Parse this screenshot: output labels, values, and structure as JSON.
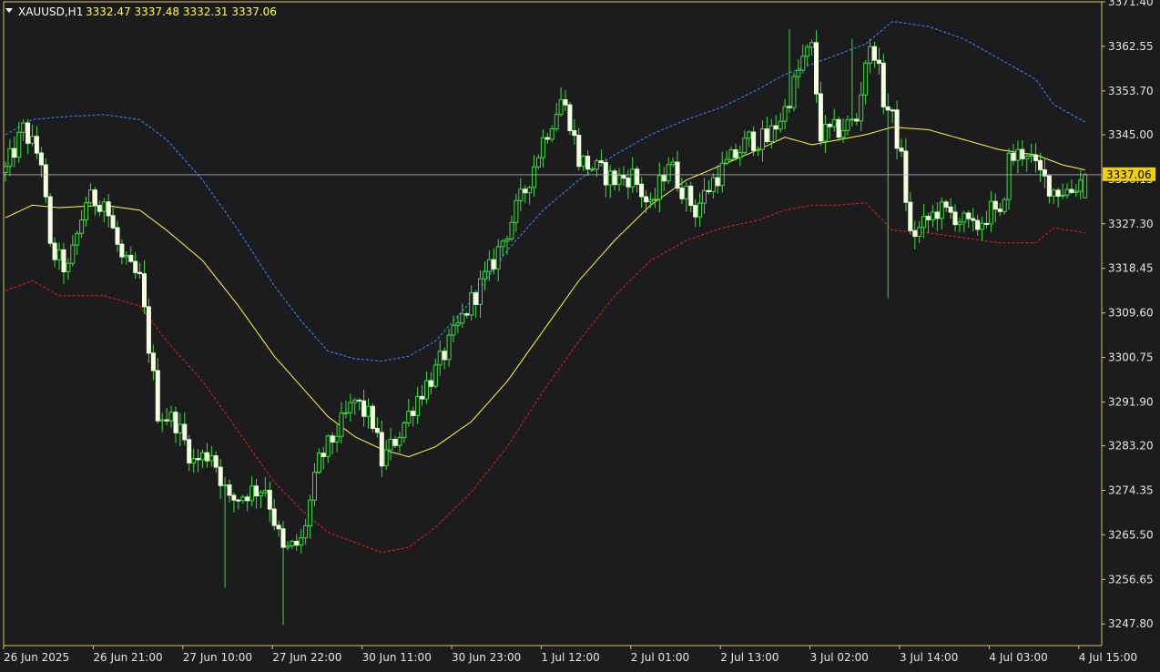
{
  "header": {
    "symbol_label": "XAUUSD,H1",
    "ohlc_label": "3332.47 3337.48 3332.31 3337.06"
  },
  "colors": {
    "background": "#1c1c1f",
    "frame": "#d8c36a",
    "axis_text": "#e6e6e6",
    "candle_body": "#f4ffe0",
    "candle_wick": "#36e03a",
    "middle_band": "#ffff33",
    "upper_band": "#3a8cff",
    "lower_band": "#e02020",
    "price_line": "#b8b8b8",
    "price_tag_bg": "#f0d000",
    "price_tag_text": "#000000"
  },
  "chart_data": {
    "type": "candlestick",
    "symbol": "XAUUSD",
    "timeframe": "H1",
    "ylim": [
      3243.5,
      3371.4
    ],
    "y_ticks": [
      3371.4,
      3362.55,
      3353.7,
      3345.0,
      3336.15,
      3327.3,
      3318.45,
      3309.6,
      3300.75,
      3291.9,
      3283.2,
      3274.35,
      3265.5,
      3256.65,
      3247.8
    ],
    "x_ticks": [
      {
        "label": "26 Jun 2025",
        "bar": 0
      },
      {
        "label": "26 Jun 21:00",
        "bar": 20
      },
      {
        "label": "27 Jun 10:00",
        "bar": 40
      },
      {
        "label": "27 Jun 22:00",
        "bar": 60
      },
      {
        "label": "30 Jun 11:00",
        "bar": 80
      },
      {
        "label": "30 Jun 23:00",
        "bar": 100
      },
      {
        "label": "1 Jul 12:00",
        "bar": 120
      },
      {
        "label": "2 Jul 01:00",
        "bar": 140
      },
      {
        "label": "2 Jul 13:00",
        "bar": 160
      },
      {
        "label": "3 Jul 02:00",
        "bar": 180
      },
      {
        "label": "3 Jul 14:00",
        "bar": 200
      },
      {
        "label": "4 Jul 03:00",
        "bar": 220
      },
      {
        "label": "4 Jul 15:00",
        "bar": 240
      }
    ],
    "current_price": 3337.06,
    "current_price_label": "3337.06",
    "close_anchors": [
      [
        0,
        3338
      ],
      [
        4,
        3346
      ],
      [
        8,
        3340
      ],
      [
        10,
        3322
      ],
      [
        14,
        3318
      ],
      [
        18,
        3332
      ],
      [
        22,
        3332
      ],
      [
        26,
        3320
      ],
      [
        30,
        3316
      ],
      [
        34,
        3290
      ],
      [
        38,
        3288
      ],
      [
        42,
        3280
      ],
      [
        46,
        3282
      ],
      [
        50,
        3272
      ],
      [
        54,
        3274
      ],
      [
        58,
        3275
      ],
      [
        62,
        3262
      ],
      [
        66,
        3264
      ],
      [
        70,
        3280
      ],
      [
        74,
        3286
      ],
      [
        78,
        3292
      ],
      [
        82,
        3288
      ],
      [
        84,
        3280
      ],
      [
        88,
        3286
      ],
      [
        92,
        3293
      ],
      [
        96,
        3298
      ],
      [
        100,
        3305
      ],
      [
        104,
        3312
      ],
      [
        108,
        3318
      ],
      [
        112,
        3326
      ],
      [
        116,
        3334
      ],
      [
        120,
        3344
      ],
      [
        124,
        3352
      ],
      [
        126,
        3348
      ],
      [
        128,
        3340
      ],
      [
        132,
        3338
      ],
      [
        136,
        3336
      ],
      [
        140,
        3337
      ],
      [
        144,
        3330
      ],
      [
        148,
        3340
      ],
      [
        150,
        3336
      ],
      [
        154,
        3330
      ],
      [
        158,
        3336
      ],
      [
        162,
        3340
      ],
      [
        166,
        3344
      ],
      [
        170,
        3344
      ],
      [
        174,
        3350
      ],
      [
        178,
        3360
      ],
      [
        180,
        3362
      ],
      [
        182,
        3345
      ],
      [
        186,
        3346
      ],
      [
        190,
        3348
      ],
      [
        192,
        3360
      ],
      [
        194,
        3362
      ],
      [
        196,
        3352
      ],
      [
        198,
        3348
      ],
      [
        200,
        3340
      ],
      [
        202,
        3325
      ],
      [
        204,
        3326
      ],
      [
        208,
        3330
      ],
      [
        212,
        3329
      ],
      [
        216,
        3326
      ],
      [
        220,
        3330
      ],
      [
        222,
        3328
      ],
      [
        224,
        3340
      ],
      [
        228,
        3342
      ],
      [
        230,
        3338
      ],
      [
        234,
        3334
      ],
      [
        238,
        3334
      ],
      [
        241,
        3337
      ]
    ],
    "bands": {
      "middle": [
        [
          0,
          3328.5
        ],
        [
          6,
          3331
        ],
        [
          12,
          3330.5
        ],
        [
          22,
          3331
        ],
        [
          30,
          3330
        ],
        [
          36,
          3326
        ],
        [
          44,
          3320
        ],
        [
          52,
          3311
        ],
        [
          60,
          3301
        ],
        [
          66,
          3295
        ],
        [
          72,
          3289
        ],
        [
          78,
          3285
        ],
        [
          84,
          3282.5
        ],
        [
          90,
          3281
        ],
        [
          96,
          3283
        ],
        [
          104,
          3288
        ],
        [
          112,
          3296
        ],
        [
          120,
          3306
        ],
        [
          128,
          3316
        ],
        [
          136,
          3324
        ],
        [
          144,
          3331
        ],
        [
          152,
          3336
        ],
        [
          160,
          3339
        ],
        [
          168,
          3342
        ],
        [
          174,
          3344.5
        ],
        [
          180,
          3343
        ],
        [
          186,
          3344
        ],
        [
          192,
          3345
        ],
        [
          198,
          3346.5
        ],
        [
          206,
          3346
        ],
        [
          214,
          3344
        ],
        [
          222,
          3342
        ],
        [
          230,
          3341
        ],
        [
          236,
          3339
        ],
        [
          241,
          3338
        ]
      ],
      "upper": [
        [
          0,
          3345
        ],
        [
          6,
          3348
        ],
        [
          12,
          3348.5
        ],
        [
          22,
          3349
        ],
        [
          30,
          3348
        ],
        [
          36,
          3344
        ],
        [
          44,
          3336
        ],
        [
          52,
          3326
        ],
        [
          60,
          3315
        ],
        [
          66,
          3308
        ],
        [
          72,
          3302
        ],
        [
          78,
          3300.5
        ],
        [
          84,
          3300
        ],
        [
          90,
          3301
        ],
        [
          96,
          3304
        ],
        [
          104,
          3312
        ],
        [
          112,
          3322
        ],
        [
          120,
          3330
        ],
        [
          128,
          3336
        ],
        [
          136,
          3341
        ],
        [
          144,
          3345
        ],
        [
          152,
          3348
        ],
        [
          160,
          3350.5
        ],
        [
          168,
          3354
        ],
        [
          174,
          3357
        ],
        [
          180,
          3359
        ],
        [
          186,
          3361
        ],
        [
          192,
          3363
        ],
        [
          198,
          3367.5
        ],
        [
          206,
          3366.5
        ],
        [
          214,
          3364
        ],
        [
          222,
          3360
        ],
        [
          230,
          3356
        ],
        [
          234,
          3351
        ],
        [
          241,
          3347.5
        ]
      ],
      "lower": [
        [
          0,
          3314
        ],
        [
          6,
          3316
        ],
        [
          12,
          3313
        ],
        [
          22,
          3313
        ],
        [
          30,
          3311
        ],
        [
          36,
          3304
        ],
        [
          44,
          3296
        ],
        [
          52,
          3286
        ],
        [
          60,
          3276
        ],
        [
          66,
          3270.5
        ],
        [
          72,
          3266
        ],
        [
          78,
          3264
        ],
        [
          84,
          3262
        ],
        [
          90,
          3263
        ],
        [
          96,
          3267
        ],
        [
          104,
          3274
        ],
        [
          112,
          3283
        ],
        [
          120,
          3294
        ],
        [
          128,
          3304
        ],
        [
          136,
          3313
        ],
        [
          144,
          3320
        ],
        [
          152,
          3324
        ],
        [
          160,
          3326.5
        ],
        [
          168,
          3328
        ],
        [
          174,
          3330
        ],
        [
          180,
          3331
        ],
        [
          186,
          3331
        ],
        [
          192,
          3331.5
        ],
        [
          198,
          3326
        ],
        [
          206,
          3325.5
        ],
        [
          214,
          3324.5
        ],
        [
          222,
          3323.5
        ],
        [
          230,
          3323.5
        ],
        [
          234,
          3326.5
        ],
        [
          241,
          3325.5
        ]
      ]
    }
  }
}
